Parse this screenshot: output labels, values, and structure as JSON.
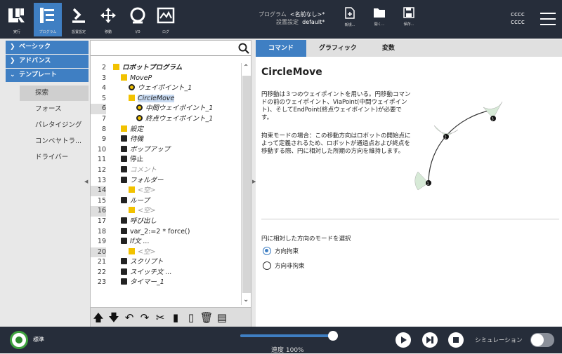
{
  "header": {
    "nav": [
      {
        "label": "実行",
        "icon": "ur-logo-icon"
      },
      {
        "label": "プログラム",
        "icon": "program-tree-icon",
        "active": true
      },
      {
        "label": "設置設定",
        "icon": "installation-icon"
      },
      {
        "label": "移動",
        "icon": "move-icon"
      },
      {
        "label": "I/O",
        "icon": "io-icon"
      },
      {
        "label": "ログ",
        "icon": "log-icon"
      }
    ],
    "program_label": "プログラム",
    "program_value": "<名前なし>*",
    "install_label": "設置設定",
    "install_value": "default*",
    "file_buttons": [
      {
        "label": "新規...",
        "icon": "new-file-icon"
      },
      {
        "label": "開く...",
        "icon": "open-folder-icon"
      },
      {
        "label": "保存...",
        "icon": "save-icon"
      }
    ],
    "user_line1": "cccc",
    "user_line2": "cccc"
  },
  "leftnav": {
    "sections": [
      {
        "label": "ベーシック",
        "chevron": ">"
      },
      {
        "label": "アドバンス",
        "chevron": ">"
      },
      {
        "label": "テンプレート",
        "chevron": "v"
      }
    ],
    "items": [
      "探索",
      "フォース",
      "パレタイジング",
      "コンベヤトラ...",
      "ドライバー"
    ],
    "selected": 0
  },
  "tree": {
    "search_placeholder": "",
    "rows": [
      {
        "num": "2",
        "text": "ロボットプログラム",
        "indent": 0,
        "icon": "y",
        "bold": true
      },
      {
        "num": "3",
        "text": "MoveP",
        "indent": 1,
        "icon": "move"
      },
      {
        "num": "4",
        "text": "ウェイポイント_1",
        "indent": 2,
        "icon": "c",
        "underline": true
      },
      {
        "num": "5",
        "text": "CircleMove",
        "indent": 2,
        "icon": "y",
        "selected": true
      },
      {
        "num": "6",
        "text": "中間ウェイポイント_1",
        "indent": 3,
        "icon": "c",
        "grey": true
      },
      {
        "num": "7",
        "text": "終点ウェイポイント_1",
        "indent": 3,
        "icon": "c"
      },
      {
        "num": "8",
        "text": "設定",
        "indent": 1,
        "icon": "y"
      },
      {
        "num": "9",
        "text": "待機",
        "indent": 1,
        "icon": "k"
      },
      {
        "num": "10",
        "text": "ポップアップ",
        "indent": 1,
        "icon": "k"
      },
      {
        "num": "11",
        "text": "停止",
        "indent": 1,
        "icon": "k",
        "plain": true
      },
      {
        "num": "12",
        "text": "コメント",
        "indent": 1,
        "icon": "k",
        "gray": true
      },
      {
        "num": "13",
        "text": "フォルダー",
        "indent": 1,
        "icon": "k"
      },
      {
        "num": "14",
        "text": "<空>",
        "indent": 2,
        "icon": "y",
        "gray": true,
        "grey": true
      },
      {
        "num": "15",
        "text": "ループ",
        "indent": 1,
        "icon": "k"
      },
      {
        "num": "16",
        "text": "<空>",
        "indent": 2,
        "icon": "y",
        "gray": true,
        "grey": true
      },
      {
        "num": "17",
        "text": "呼び出し",
        "indent": 1,
        "icon": "k"
      },
      {
        "num": "18",
        "text": "var_2:=2 * force()",
        "indent": 1,
        "icon": "k",
        "plain": true
      },
      {
        "num": "19",
        "text": "If文 ...",
        "indent": 1,
        "icon": "k"
      },
      {
        "num": "20",
        "text": "<空>",
        "indent": 2,
        "icon": "y",
        "gray": true,
        "grey": true
      },
      {
        "num": "21",
        "text": "スクリプト",
        "indent": 1,
        "icon": "k"
      },
      {
        "num": "22",
        "text": "スイッチ文 ...",
        "indent": 1,
        "icon": "k"
      },
      {
        "num": "23",
        "text": "タイマー_1",
        "indent": 1,
        "icon": "k"
      }
    ],
    "toolbar": [
      "🡅",
      "🡇",
      "↶",
      "↷",
      "✂",
      "▮",
      "▯",
      "🗑",
      "▤"
    ]
  },
  "panel": {
    "tabs": [
      "コマンド",
      "グラフィック",
      "変数"
    ],
    "active_tab": 0,
    "title": "CircleMove",
    "description1": "円移動は３つのウェイポイントを用いる。円移動コマンドの前のウェイポイント、ViaPoint(中間ウェイポイント)、そしてEndPoint(終点ウェイポイント)が必要です。",
    "description2": "拘束モードの場合：この移動方向はロボットの開始点によって定義されるため、ロボットが通過点および終点を移動する際、円に相対した所期の方向を維持します。",
    "diagram_points": [
      "1",
      "2",
      "3"
    ],
    "mode_label": "円に相対した方向のモードを選択",
    "options": [
      "方向拘束",
      "方向非拘束"
    ],
    "selected_option": 0
  },
  "bottom": {
    "status": "標準",
    "speed_label": "速度 100%",
    "speed_fraction": 1.0,
    "sim_label": "シミュレーション",
    "accent": "#3f7fc3",
    "power_color": "#3fa33f"
  }
}
